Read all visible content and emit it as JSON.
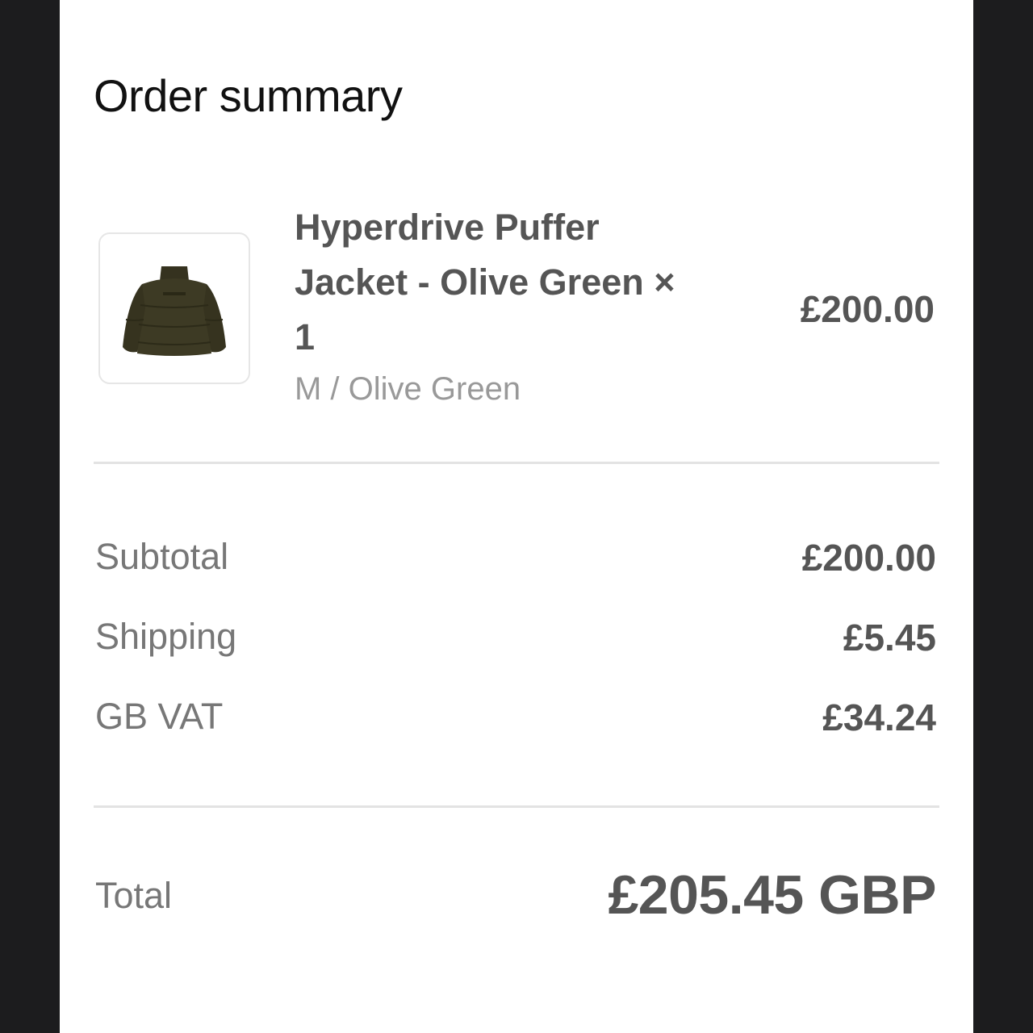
{
  "order": {
    "title": "Order summary"
  },
  "product": {
    "thumbnail_icon": "puffer-jacket-icon",
    "name": "Hyperdrive Puffer Jacket - Olive Green × 1",
    "variant": "M / Olive Green",
    "price": "£200.00",
    "jacket_color": "#3d3a24"
  },
  "summary": {
    "subtotal_label": "Subtotal",
    "subtotal_value": "£200.00",
    "shipping_label": "Shipping",
    "shipping_value": "£5.45",
    "vat_label": "GB VAT",
    "vat_value": "£34.24",
    "total_label": "Total",
    "total_value": "£205.45 GBP"
  },
  "colors": {
    "background": "#1c1c1e",
    "panel": "#ffffff",
    "divider": "#e3e3e3"
  }
}
